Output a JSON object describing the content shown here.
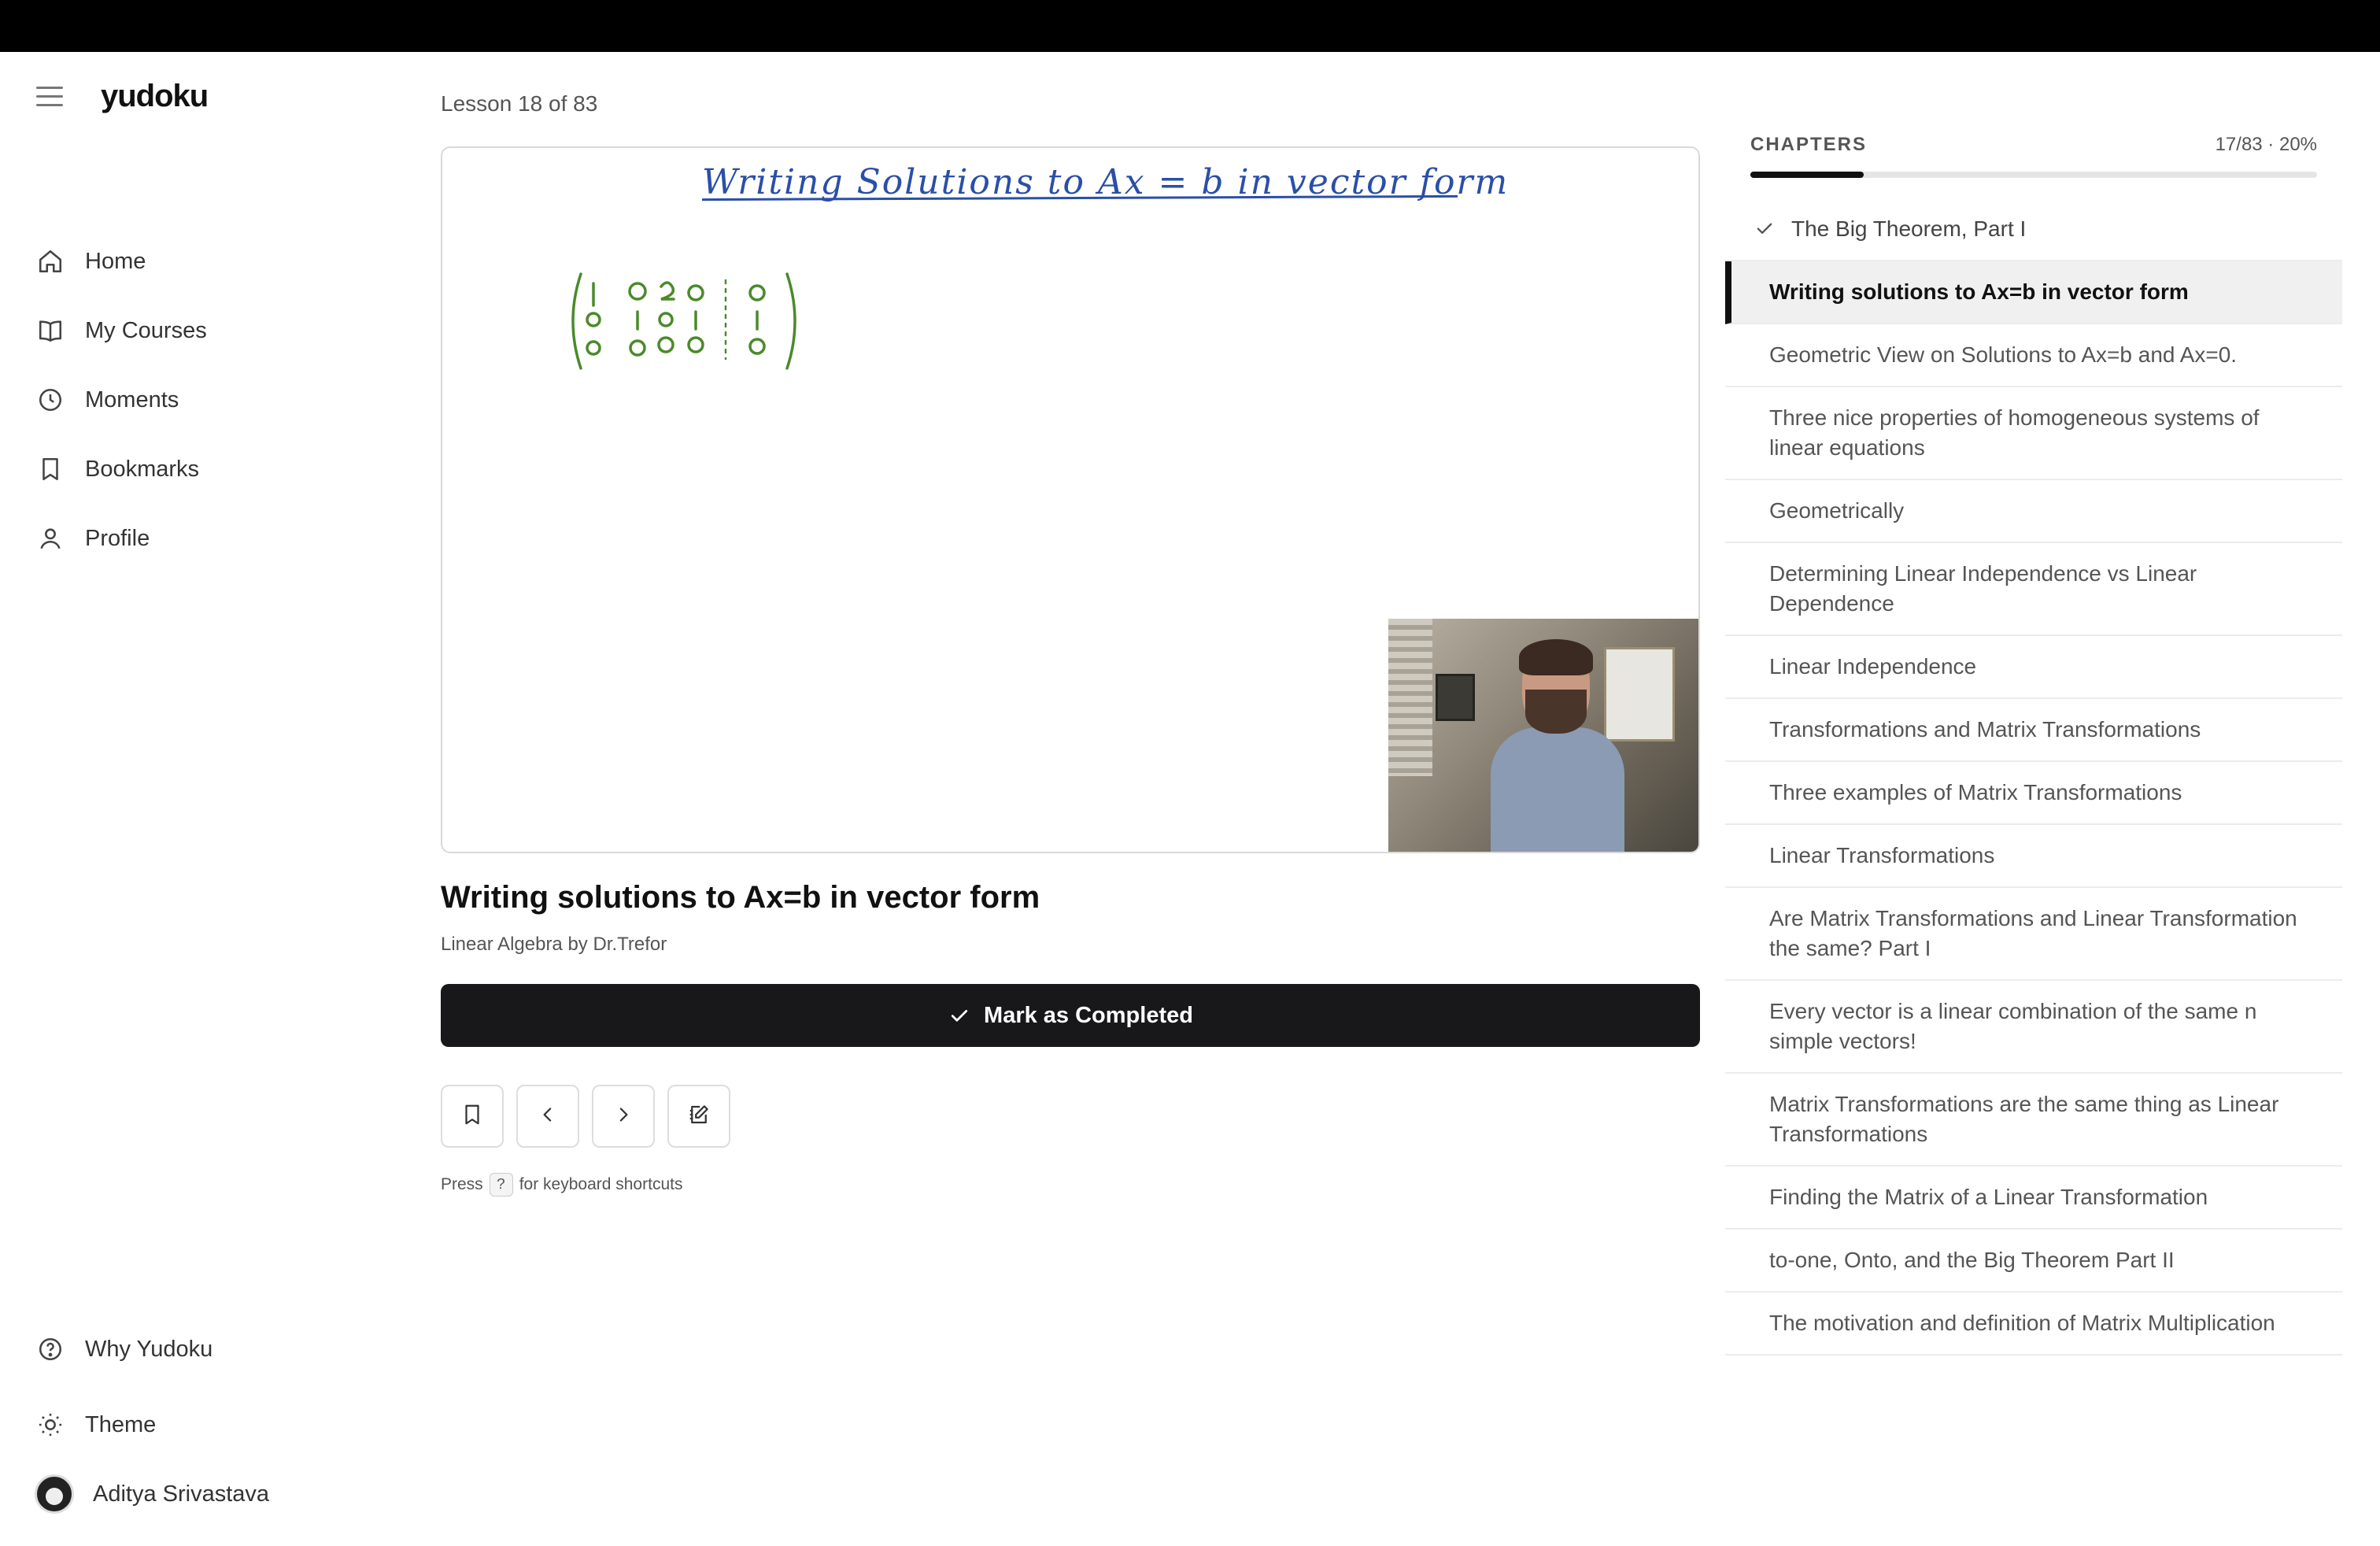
{
  "app": {
    "logo": "yudoku"
  },
  "sidebar": {
    "items": [
      {
        "label": "Home",
        "icon": "home-icon"
      },
      {
        "label": "My Courses",
        "icon": "book-icon"
      },
      {
        "label": "Moments",
        "icon": "clock-icon"
      },
      {
        "label": "Bookmarks",
        "icon": "bookmark-icon"
      },
      {
        "label": "Profile",
        "icon": "user-icon"
      }
    ],
    "why": "Why Yudoku",
    "theme": "Theme",
    "user": "Aditya Srivastava"
  },
  "main": {
    "lesson_count": "Lesson 18 of 83",
    "whiteboard_title": "Writing Solutions to Ax = b in vector form",
    "title": "Writing solutions to Ax=b in vector form",
    "course": "Linear Algebra by Dr.Trefor",
    "complete_label": "Mark as Completed",
    "hint_before": "Press",
    "hint_key": "?",
    "hint_after": "for keyboard shortcuts"
  },
  "chapters": {
    "heading": "CHAPTERS",
    "progress_text": "17/83 · 20%",
    "progress": 0.2,
    "items": [
      {
        "label": "The Big Theorem, Part I",
        "state": "done"
      },
      {
        "label": "Writing solutions to Ax=b in vector form",
        "state": "active"
      },
      {
        "label": "Geometric View on Solutions to Ax=b and Ax=0.",
        "state": ""
      },
      {
        "label": "Three nice properties of homogeneous systems of linear equations",
        "state": ""
      },
      {
        "label": "Geometrically",
        "state": ""
      },
      {
        "label": "Determining Linear Independence vs Linear Dependence",
        "state": ""
      },
      {
        "label": "Linear Independence",
        "state": ""
      },
      {
        "label": "Transformations and Matrix Transformations",
        "state": ""
      },
      {
        "label": "Three examples of Matrix Transformations",
        "state": ""
      },
      {
        "label": "Linear Transformations",
        "state": ""
      },
      {
        "label": "Are Matrix Transformations and Linear Transformation the same? Part I",
        "state": ""
      },
      {
        "label": "Every vector is a linear combination of the same n simple vectors!",
        "state": ""
      },
      {
        "label": "Matrix Transformations are the same thing as Linear Transformations",
        "state": ""
      },
      {
        "label": "Finding the Matrix of a Linear Transformation",
        "state": ""
      },
      {
        "label": "to-one, Onto, and the Big Theorem Part II",
        "state": ""
      },
      {
        "label": "The motivation and definition of Matrix Multiplication",
        "state": ""
      }
    ]
  },
  "colors": {
    "accent": "#18181b",
    "whiteboard_ink": "#2a4fa8",
    "matrix_ink": "#4a8a2a"
  }
}
